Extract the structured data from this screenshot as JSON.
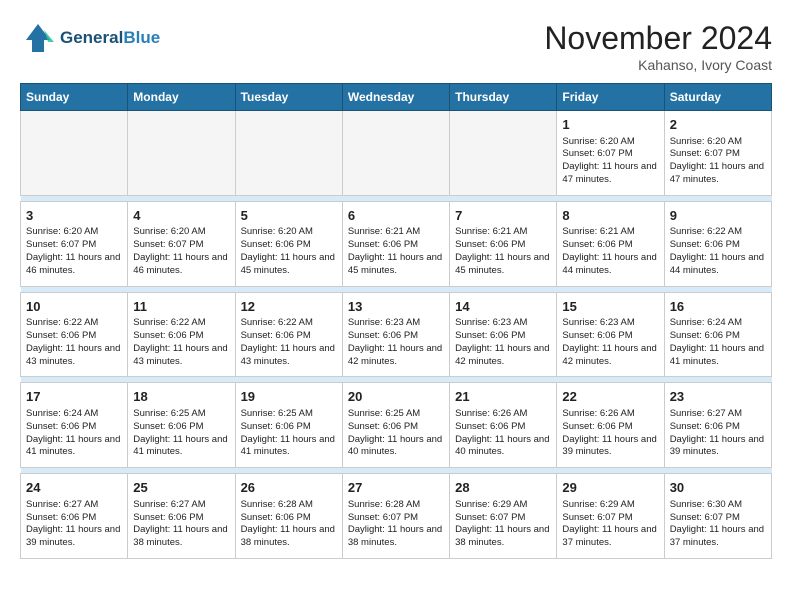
{
  "header": {
    "logo_line1": "General",
    "logo_line2": "Blue",
    "month": "November 2024",
    "location": "Kahanso, Ivory Coast"
  },
  "days_of_week": [
    "Sunday",
    "Monday",
    "Tuesday",
    "Wednesday",
    "Thursday",
    "Friday",
    "Saturday"
  ],
  "weeks": [
    [
      {
        "day": "",
        "info": ""
      },
      {
        "day": "",
        "info": ""
      },
      {
        "day": "",
        "info": ""
      },
      {
        "day": "",
        "info": ""
      },
      {
        "day": "",
        "info": ""
      },
      {
        "day": "1",
        "info": "Sunrise: 6:20 AM\nSunset: 6:07 PM\nDaylight: 11 hours and 47 minutes."
      },
      {
        "day": "2",
        "info": "Sunrise: 6:20 AM\nSunset: 6:07 PM\nDaylight: 11 hours and 47 minutes."
      }
    ],
    [
      {
        "day": "3",
        "info": "Sunrise: 6:20 AM\nSunset: 6:07 PM\nDaylight: 11 hours and 46 minutes."
      },
      {
        "day": "4",
        "info": "Sunrise: 6:20 AM\nSunset: 6:07 PM\nDaylight: 11 hours and 46 minutes."
      },
      {
        "day": "5",
        "info": "Sunrise: 6:20 AM\nSunset: 6:06 PM\nDaylight: 11 hours and 45 minutes."
      },
      {
        "day": "6",
        "info": "Sunrise: 6:21 AM\nSunset: 6:06 PM\nDaylight: 11 hours and 45 minutes."
      },
      {
        "day": "7",
        "info": "Sunrise: 6:21 AM\nSunset: 6:06 PM\nDaylight: 11 hours and 45 minutes."
      },
      {
        "day": "8",
        "info": "Sunrise: 6:21 AM\nSunset: 6:06 PM\nDaylight: 11 hours and 44 minutes."
      },
      {
        "day": "9",
        "info": "Sunrise: 6:22 AM\nSunset: 6:06 PM\nDaylight: 11 hours and 44 minutes."
      }
    ],
    [
      {
        "day": "10",
        "info": "Sunrise: 6:22 AM\nSunset: 6:06 PM\nDaylight: 11 hours and 43 minutes."
      },
      {
        "day": "11",
        "info": "Sunrise: 6:22 AM\nSunset: 6:06 PM\nDaylight: 11 hours and 43 minutes."
      },
      {
        "day": "12",
        "info": "Sunrise: 6:22 AM\nSunset: 6:06 PM\nDaylight: 11 hours and 43 minutes."
      },
      {
        "day": "13",
        "info": "Sunrise: 6:23 AM\nSunset: 6:06 PM\nDaylight: 11 hours and 42 minutes."
      },
      {
        "day": "14",
        "info": "Sunrise: 6:23 AM\nSunset: 6:06 PM\nDaylight: 11 hours and 42 minutes."
      },
      {
        "day": "15",
        "info": "Sunrise: 6:23 AM\nSunset: 6:06 PM\nDaylight: 11 hours and 42 minutes."
      },
      {
        "day": "16",
        "info": "Sunrise: 6:24 AM\nSunset: 6:06 PM\nDaylight: 11 hours and 41 minutes."
      }
    ],
    [
      {
        "day": "17",
        "info": "Sunrise: 6:24 AM\nSunset: 6:06 PM\nDaylight: 11 hours and 41 minutes."
      },
      {
        "day": "18",
        "info": "Sunrise: 6:25 AM\nSunset: 6:06 PM\nDaylight: 11 hours and 41 minutes."
      },
      {
        "day": "19",
        "info": "Sunrise: 6:25 AM\nSunset: 6:06 PM\nDaylight: 11 hours and 41 minutes."
      },
      {
        "day": "20",
        "info": "Sunrise: 6:25 AM\nSunset: 6:06 PM\nDaylight: 11 hours and 40 minutes."
      },
      {
        "day": "21",
        "info": "Sunrise: 6:26 AM\nSunset: 6:06 PM\nDaylight: 11 hours and 40 minutes."
      },
      {
        "day": "22",
        "info": "Sunrise: 6:26 AM\nSunset: 6:06 PM\nDaylight: 11 hours and 39 minutes."
      },
      {
        "day": "23",
        "info": "Sunrise: 6:27 AM\nSunset: 6:06 PM\nDaylight: 11 hours and 39 minutes."
      }
    ],
    [
      {
        "day": "24",
        "info": "Sunrise: 6:27 AM\nSunset: 6:06 PM\nDaylight: 11 hours and 39 minutes."
      },
      {
        "day": "25",
        "info": "Sunrise: 6:27 AM\nSunset: 6:06 PM\nDaylight: 11 hours and 38 minutes."
      },
      {
        "day": "26",
        "info": "Sunrise: 6:28 AM\nSunset: 6:06 PM\nDaylight: 11 hours and 38 minutes."
      },
      {
        "day": "27",
        "info": "Sunrise: 6:28 AM\nSunset: 6:07 PM\nDaylight: 11 hours and 38 minutes."
      },
      {
        "day": "28",
        "info": "Sunrise: 6:29 AM\nSunset: 6:07 PM\nDaylight: 11 hours and 38 minutes."
      },
      {
        "day": "29",
        "info": "Sunrise: 6:29 AM\nSunset: 6:07 PM\nDaylight: 11 hours and 37 minutes."
      },
      {
        "day": "30",
        "info": "Sunrise: 6:30 AM\nSunset: 6:07 PM\nDaylight: 11 hours and 37 minutes."
      }
    ]
  ]
}
